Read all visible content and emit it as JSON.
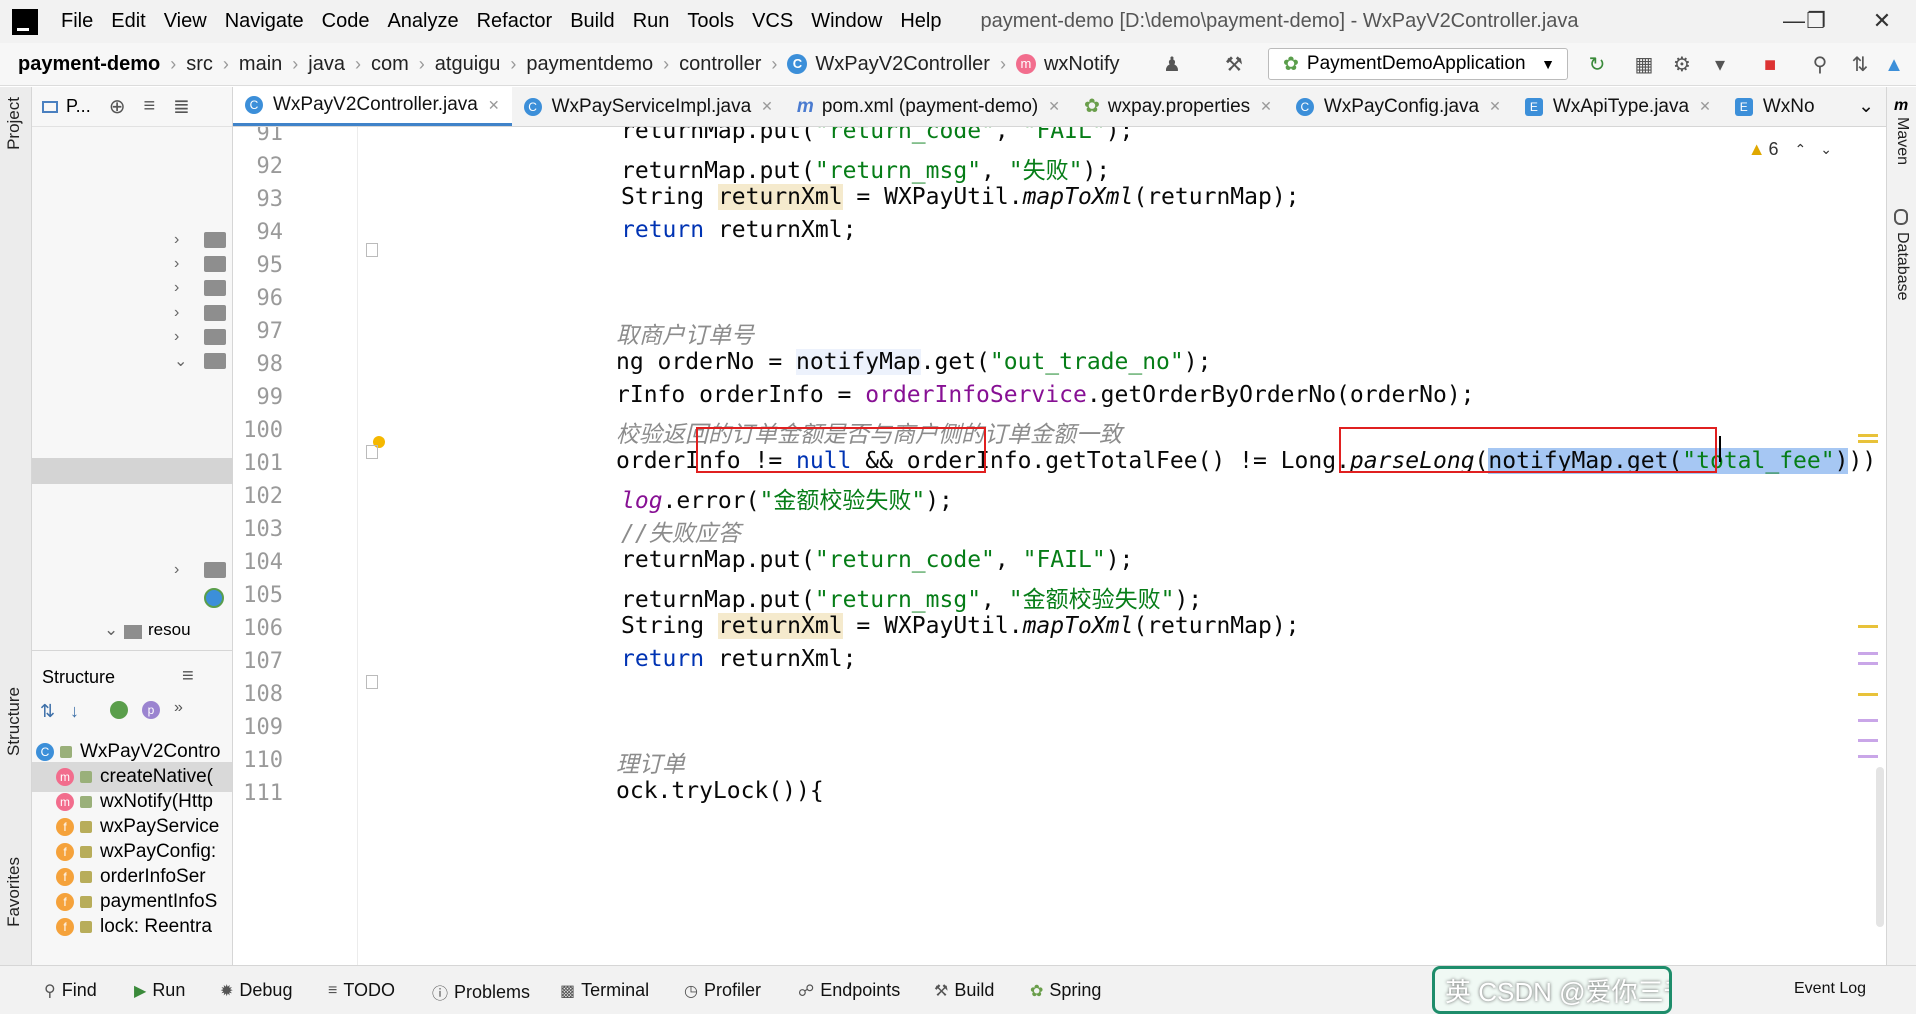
{
  "menubar": {
    "items": [
      "File",
      "Edit",
      "View",
      "Navigate",
      "Code",
      "Analyze",
      "Refactor",
      "Build",
      "Run",
      "Tools",
      "VCS",
      "Window",
      "Help"
    ],
    "title": "payment-demo [D:\\demo\\payment-demo] - WxPayV2Controller.java"
  },
  "navbar": {
    "project": "payment-demo",
    "crumbs": [
      "src",
      "main",
      "java",
      "com",
      "atguigu",
      "paymentdemo",
      "controller",
      "WxPayV2Controller",
      "wxNotify"
    ],
    "run_config": "PaymentDemoApplication"
  },
  "sidebar": {
    "project_tab": "Project",
    "structure_tab": "Structure",
    "favorites_tab": "Favorites",
    "project_header": "P...",
    "resources_label": "resou"
  },
  "right_strip": {
    "maven": "Maven",
    "database": "Database"
  },
  "tabs": [
    {
      "label": "WxPayV2Controller.java",
      "icon": "C",
      "active": true
    },
    {
      "label": "WxPayServiceImpl.java",
      "icon": "C",
      "active": false
    },
    {
      "label": "pom.xml (payment-demo)",
      "icon": "m",
      "active": false
    },
    {
      "label": "wxpay.properties",
      "icon": "leaf",
      "active": false
    },
    {
      "label": "WxPayConfig.java",
      "icon": "C",
      "active": false
    },
    {
      "label": "WxApiType.java",
      "icon": "E",
      "active": false
    },
    {
      "label": "WxNo",
      "icon": "E",
      "active": false
    }
  ],
  "structure": {
    "title": "Structure",
    "items": [
      {
        "badge": "C",
        "label": "WxPayV2Contro"
      },
      {
        "badge": "m",
        "label": "createNative("
      },
      {
        "badge": "m",
        "label": "wxNotify(Http"
      },
      {
        "badge": "f",
        "label": "wxPayService"
      },
      {
        "badge": "f",
        "label": "wxPayConfig:"
      },
      {
        "badge": "f",
        "label": "orderInfoSer"
      },
      {
        "badge": "f",
        "label": "paymentInfoS"
      },
      {
        "badge": "f",
        "label": "lock: Reentra"
      }
    ]
  },
  "editor": {
    "warnings": "6",
    "line_numbers": [
      "91",
      "92",
      "93",
      "94",
      "95",
      "96",
      "97",
      "98",
      "99",
      "100",
      "101",
      "102",
      "103",
      "104",
      "105",
      "106",
      "107",
      "108",
      "109",
      "110",
      "111"
    ],
    "lines": {
      "l91": {
        "a": "returnMap.put(",
        "s1": "\"return_code\"",
        "b": ", ",
        "s2": "\"FAIL\"",
        "c": ");"
      },
      "l92": {
        "a": "returnMap.put(",
        "s1": "\"return_msg\"",
        "b": ", ",
        "s2": "\"失败\"",
        "c": ");"
      },
      "l93": {
        "a": "String ",
        "v": "returnXml",
        "b": " = WXPayUtil.",
        "m": "mapToXml",
        "c": "(returnMap);"
      },
      "l94": {
        "k": "return",
        "b": " returnXml;"
      },
      "l97": {
        "cm": "取商户订单号"
      },
      "l98": {
        "a": "ng orderNo = ",
        "v": "notifyMap",
        "b": ".get(",
        "s": "\"out_trade_no\"",
        "c": ");"
      },
      "l99": {
        "a": "rInfo orderInfo = ",
        "f": "orderInfoService",
        "b": ".getOrderByOrderNo(orderNo);"
      },
      "l100": {
        "cm": "校验返回的订单金额是否与商户侧的订单金额一致"
      },
      "l101": {
        "a": "orderInfo != ",
        "k": "null",
        "b": " && ",
        "box1": "orderInfo.getTotalFee()",
        "c": " != Long.",
        "m": "parseLong",
        "d": "(",
        "sel": "notifyMap.get(",
        "s": "\"total_fee\"",
        "sel2": ")",
        "e": ")) {"
      },
      "l102": {
        "f": "log",
        "a": ".error(",
        "s": "\"金额校验失败\"",
        "b": ");"
      },
      "l103": {
        "cm": "//失败应答"
      },
      "l104": {
        "a": "returnMap.put(",
        "s1": "\"return_code\"",
        "b": ", ",
        "s2": "\"FAIL\"",
        "c": ");"
      },
      "l105": {
        "a": "returnMap.put(",
        "s1": "\"return_msg\"",
        "b": ", ",
        "s2": "\"金额校验失败\"",
        "c": ");"
      },
      "l106": {
        "a": "String ",
        "v": "returnXml",
        "b": " = WXPayUtil.",
        "m": "mapToXml",
        "c": "(returnMap);"
      },
      "l107": {
        "k": "return",
        "b": " returnXml;"
      },
      "l110": {
        "cm": "理订单"
      },
      "l111": {
        "a": "ock.tryLock()){"
      }
    }
  },
  "bottom_tools": [
    "Find",
    "Run",
    "Debug",
    "TODO",
    "Problems",
    "Terminal",
    "Profiler",
    "Endpoints",
    "Build",
    "Spring"
  ],
  "event_log": "Event Log",
  "watermark": "英 CSDN @爱你三千遍斯塔克"
}
